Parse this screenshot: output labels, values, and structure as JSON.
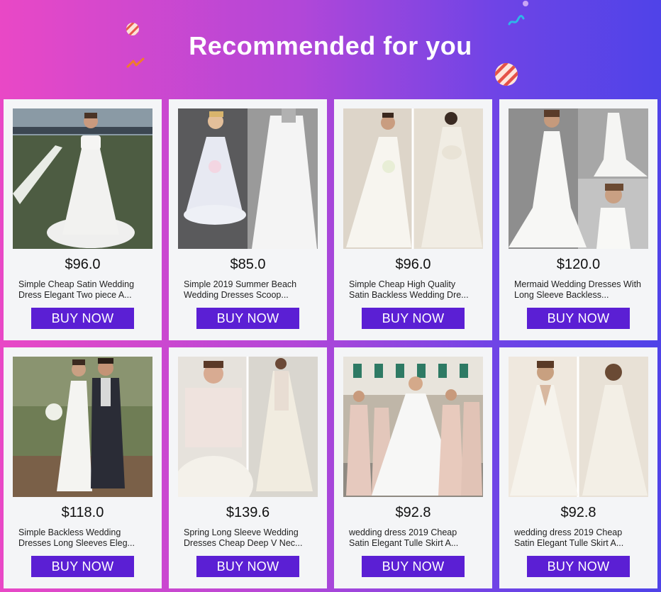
{
  "header": {
    "title": "Recommended for you"
  },
  "button_color": "#5b1fd4",
  "products": [
    {
      "price": "$96.0",
      "name": "Simple Cheap Satin Wedding Dress Elegant Two piece A...",
      "buy_label": "BUY NOW",
      "image": "two-piece-satin-wedding-dress-photo"
    },
    {
      "price": "$85.0",
      "name": "Simple 2019 Summer Beach Wedding Dresses Scoop...",
      "buy_label": "BUY NOW",
      "image": "tulle-tea-length-wedding-dress-photo"
    },
    {
      "price": "$96.0",
      "name": "Simple Cheap High Quality Satin Backless Wedding Dre...",
      "buy_label": "BUY NOW",
      "image": "satin-backless-bow-wedding-dress-photo"
    },
    {
      "price": "$120.0",
      "name": "Mermaid Wedding Dresses With Long Sleeve Backless...",
      "buy_label": "BUY NOW",
      "image": "mermaid-long-sleeve-wedding-dress-photo"
    },
    {
      "price": "$118.0",
      "name": "Simple Backless Wedding Dresses Long Sleeves Eleg...",
      "buy_label": "BUY NOW",
      "image": "bride-and-groom-outdoor-photo"
    },
    {
      "price": "$139.6",
      "name": "Spring Long Sleeve Wedding Dresses Cheap Deep V Nec...",
      "buy_label": "BUY NOW",
      "image": "lace-long-sleeve-wedding-dress-photo"
    },
    {
      "price": "$92.8",
      "name": "wedding dress 2019 Cheap Satin Elegant Tulle Skirt A...",
      "buy_label": "BUY NOW",
      "image": "bride-with-bridesmaids-photo"
    },
    {
      "price": "$92.8",
      "name": "wedding dress 2019 Cheap Satin Elegant Tulle Skirt A...",
      "buy_label": "BUY NOW",
      "image": "v-neck-satin-wedding-dress-photo"
    }
  ]
}
